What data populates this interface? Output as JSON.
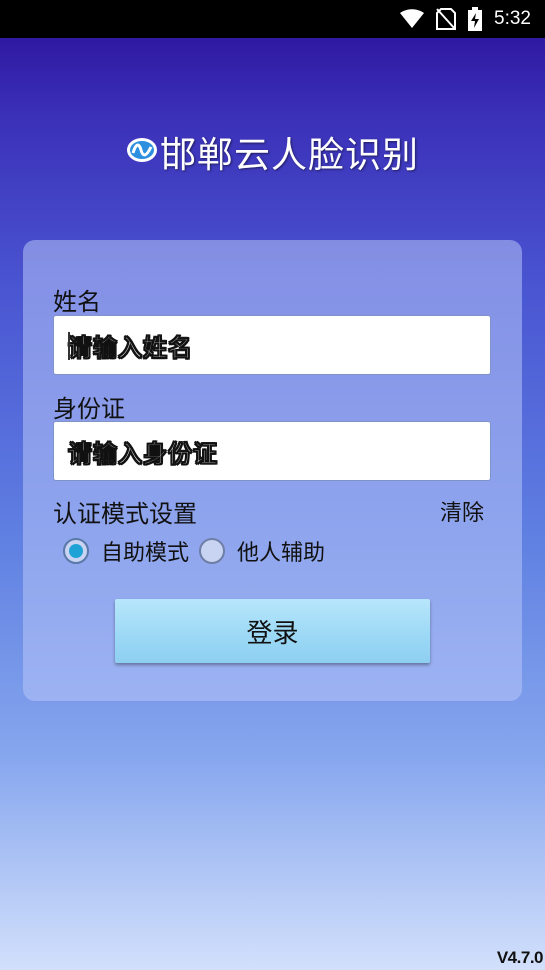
{
  "status_bar": {
    "time": "5:32",
    "icons": [
      "wifi-icon",
      "no-sim-icon",
      "battery-charging-icon"
    ]
  },
  "app": {
    "logo_icon": "app-logo-icon",
    "title": "邯郸云人脸识别",
    "version": "V4.7.0"
  },
  "form": {
    "name_label": "姓名",
    "name_placeholder": "请输入姓名",
    "id_label": "身份证",
    "id_placeholder": "请输入身份证",
    "mode_label": "认证模式设置",
    "clear_label": "清除",
    "modes": [
      {
        "label": "自助模式",
        "checked": true
      },
      {
        "label": "他人辅助",
        "checked": false
      }
    ],
    "login_label": "登录"
  },
  "colors": {
    "background_top": "#2a0e99",
    "background_bottom": "#d2e0fb",
    "button": "#9bd8f5",
    "radio_checked": "#1fa3d6"
  }
}
